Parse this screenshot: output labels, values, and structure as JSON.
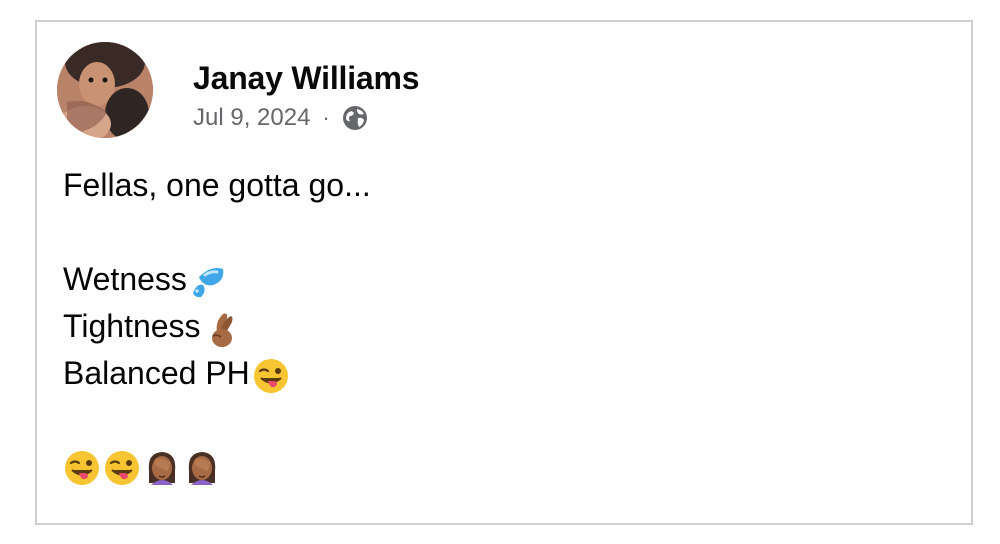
{
  "post": {
    "author": "Janay Williams",
    "date": "Jul 9, 2024",
    "separator": "·",
    "privacy_icon": "globe-icon",
    "lines": [
      {
        "text": "Fellas, one gotta go...",
        "emoji": ""
      },
      {
        "text": "",
        "emoji": ""
      },
      {
        "text": "Wetness",
        "emoji": "sweat-droplets-emoji"
      },
      {
        "text": "Tightness",
        "emoji": "crossed-fingers-emoji"
      },
      {
        "text": "Balanced PH",
        "emoji": "winking-tongue-face-emoji"
      },
      {
        "text": "",
        "emoji": ""
      }
    ],
    "final_emojis": [
      "winking-tongue-face-emoji",
      "winking-tongue-face-emoji",
      "facepalm-woman-emoji",
      "facepalm-woman-emoji"
    ]
  },
  "colors": {
    "text": "#050505",
    "meta": "#65676b",
    "border": "#cfcfd2"
  }
}
